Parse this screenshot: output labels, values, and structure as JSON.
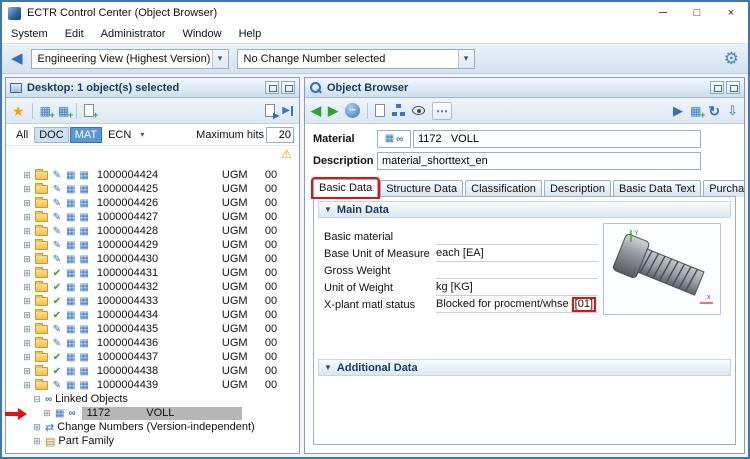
{
  "window": {
    "title": "ECTR Control Center (Object Browser)",
    "controls": {
      "minimize": "─",
      "maximize": "□",
      "close": "×"
    },
    "menu": [
      "System",
      "Edit",
      "Administrator",
      "Window",
      "Help"
    ],
    "toolbar": {
      "view_select": "Engineering View (Highest Version)",
      "change_select": "No Change Number selected"
    }
  },
  "icons": {
    "caret": "▾",
    "back": "◀",
    "gear": "⚙",
    "star": "★",
    "warning": "⚠",
    "grid": "▦",
    "expand": "⊞",
    "collapse": "⊟",
    "chain": "∞",
    "nav_back": "◀",
    "nav_forward": "▶",
    "overflow": "⋯",
    "refresh": "↻",
    "import": "⇩",
    "blue_arrow": "▶",
    "plus": "+",
    "scroll_left": "◀",
    "scroll_right": "▶",
    "section": "▼",
    "change": "⇄",
    "family": "▤",
    "dots": "•••"
  },
  "desktop_panel": {
    "title": "Desktop: 1 object(s) selected",
    "filter": {
      "tabs": [
        {
          "label": "All",
          "state": "normal"
        },
        {
          "label": "DOC",
          "state": "partial"
        },
        {
          "label": "MAT",
          "state": "selected"
        },
        {
          "label": "ECN",
          "state": "normal"
        }
      ],
      "max_hits_label": "Maximum hits",
      "max_hits_value": "20"
    },
    "rows": [
      {
        "id": "1000004424",
        "group": "UGM",
        "ver": "00",
        "status": "pencil"
      },
      {
        "id": "1000004425",
        "group": "UGM",
        "ver": "00",
        "status": "pencil"
      },
      {
        "id": "1000004426",
        "group": "UGM",
        "ver": "00",
        "status": "pencil"
      },
      {
        "id": "1000004427",
        "group": "UGM",
        "ver": "00",
        "status": "pencil"
      },
      {
        "id": "1000004428",
        "group": "UGM",
        "ver": "00",
        "status": "pencil"
      },
      {
        "id": "1000004429",
        "group": "UGM",
        "ver": "00",
        "status": "pencil"
      },
      {
        "id": "1000004430",
        "group": "UGM",
        "ver": "00",
        "status": "pencil"
      },
      {
        "id": "1000004431",
        "group": "UGM",
        "ver": "00",
        "status": "check"
      },
      {
        "id": "1000004432",
        "group": "UGM",
        "ver": "00",
        "status": "check"
      },
      {
        "id": "1000004433",
        "group": "UGM",
        "ver": "00",
        "status": "check"
      },
      {
        "id": "1000004434",
        "group": "UGM",
        "ver": "00",
        "status": "check"
      },
      {
        "id": "1000004435",
        "group": "UGM",
        "ver": "00",
        "status": "pencil"
      },
      {
        "id": "1000004436",
        "group": "UGM",
        "ver": "00",
        "status": "pencil"
      },
      {
        "id": "1000004437",
        "group": "UGM",
        "ver": "00",
        "status": "check"
      },
      {
        "id": "1000004438",
        "group": "UGM",
        "ver": "00",
        "status": "check"
      },
      {
        "id": "1000004439",
        "group": "UGM",
        "ver": "00",
        "status": "pencil"
      }
    ],
    "linked_objects_label": "Linked Objects",
    "linked_item": {
      "id": "1172",
      "name": "VOLL"
    },
    "change_numbers_label": "Change Numbers (Version-independent)",
    "part_family_label": "Part Family"
  },
  "object_browser": {
    "title": "Object Browser",
    "material_label": "Material",
    "material_value": "1172   VOLL",
    "description_label": "Description",
    "description_value": "material_shorttext_en",
    "tabs": [
      {
        "label": "Basic Data",
        "flags": "active annotated"
      },
      {
        "label": "Structure Data",
        "flags": ""
      },
      {
        "label": "Classification",
        "flags": ""
      },
      {
        "label": "Description",
        "flags": ""
      },
      {
        "label": "Basic Data Text",
        "flags": ""
      },
      {
        "label": "Purchase Ord...",
        "flags": ""
      }
    ],
    "main_data": {
      "label": "Main Data",
      "fields": [
        {
          "label": "Basic material",
          "value": ""
        },
        {
          "label": "Base Unit of Measure",
          "value": "each [EA]"
        },
        {
          "label": "Gross Weight",
          "value": ""
        },
        {
          "label": "Unit of Weight",
          "value": "kg [KG]"
        },
        {
          "label": "X-plant matl status",
          "value": "Blocked for procment/whse",
          "badge": "[01]"
        }
      ]
    },
    "additional_data_label": "Additional Data"
  },
  "colors": {
    "annotation_red": "#e01111",
    "accent_blue": "#2f6fbe",
    "selection_gray": "#b6b6b6",
    "toolbar_blue": "#d3e1f0"
  }
}
